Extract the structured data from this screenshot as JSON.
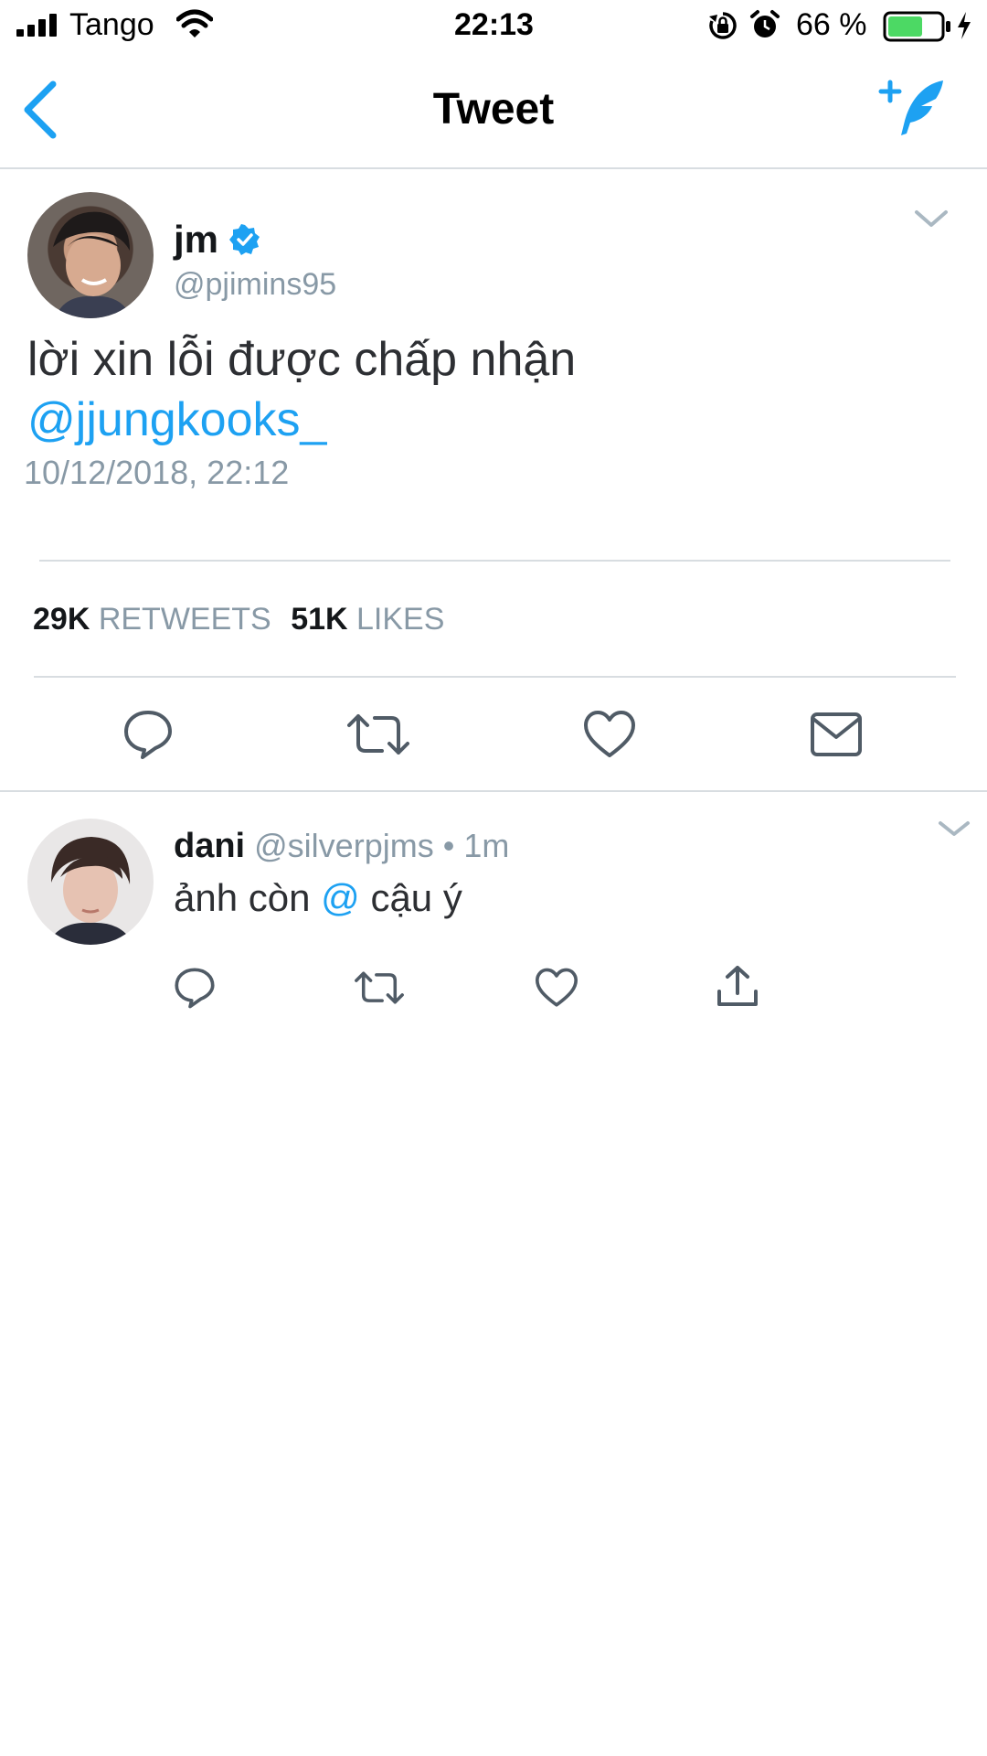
{
  "status_bar": {
    "carrier": "Tango",
    "time": "22:13",
    "battery_percent": "66 %",
    "battery_level": 0.66,
    "icons": [
      "signal-icon",
      "wifi-icon",
      "rotation-lock-icon",
      "alarm-icon",
      "battery-icon",
      "charging-icon"
    ]
  },
  "nav": {
    "title": "Tweet",
    "back_icon": "chevron-left-icon",
    "compose_icon": "compose-tweet-icon"
  },
  "tweet": {
    "display_name": "jm",
    "handle": "@pjimins95",
    "verified": true,
    "text": "lời xin lỗi được chấp nhận",
    "mention": "@jjungkooks_",
    "timestamp": "10/12/2018, 22:12",
    "retweets_count": "29K",
    "retweets_label": "RETWEETS",
    "likes_count": "51K",
    "likes_label": "LIKES",
    "actions": [
      "reply-icon",
      "retweet-icon",
      "like-icon",
      "direct-message-icon"
    ]
  },
  "reply": {
    "display_name": "dani",
    "handle": "@silverpjms",
    "separator": "•",
    "time_ago": "1m",
    "text_before": "ảnh còn",
    "mention": "@",
    "text_after": "cậu ý",
    "actions": [
      "reply-icon",
      "retweet-icon",
      "like-icon",
      "share-icon"
    ]
  },
  "colors": {
    "accent": "#1da1f2",
    "verified": "#1da1f2",
    "secondary_text": "#8899a6",
    "divider": "#d8dde1",
    "battery_green": "#4cd964"
  }
}
